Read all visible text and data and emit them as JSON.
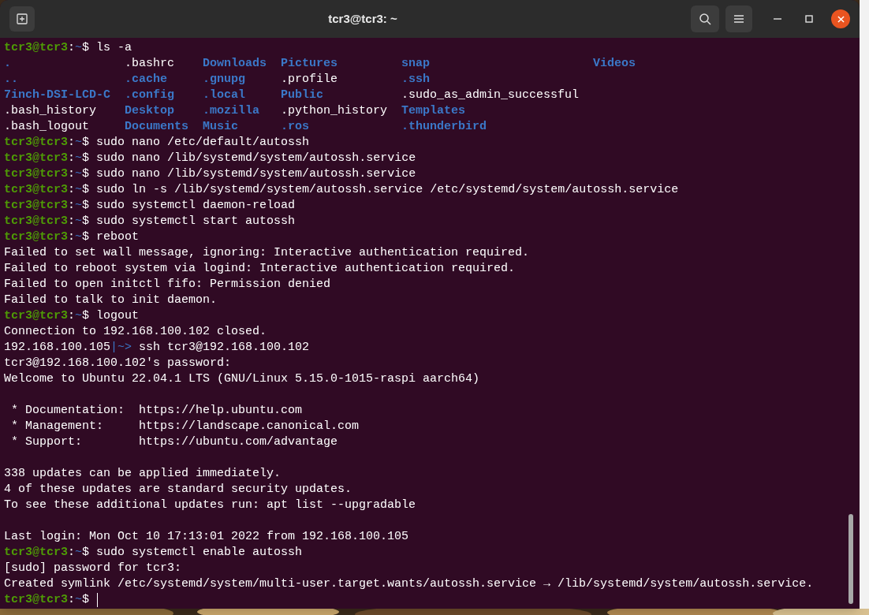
{
  "window": {
    "title": "tcr3@tcr3: ~"
  },
  "terminal": {
    "lines": [
      {
        "kind": "prompt",
        "user_host": "tcr3@tcr3",
        "sep": ":",
        "path": "~",
        "sign": "$",
        "command": "ls -a"
      },
      {
        "kind": "listing",
        "rows": [
          [
            {
              "name": ".",
              "kind": "dir"
            },
            {
              "name": ".bashrc",
              "kind": "file"
            },
            {
              "name": "Downloads",
              "kind": "dir"
            },
            {
              "name": "Pictures",
              "kind": "dir"
            },
            {
              "name": "snap",
              "kind": "dir"
            },
            {
              "name": "Videos",
              "kind": "dir"
            }
          ],
          [
            {
              "name": "..",
              "kind": "dir"
            },
            {
              "name": ".cache",
              "kind": "dir"
            },
            {
              "name": ".gnupg",
              "kind": "dir"
            },
            {
              "name": ".profile",
              "kind": "file"
            },
            {
              "name": ".ssh",
              "kind": "dir"
            }
          ],
          [
            {
              "name": "7inch-DSI-LCD-C",
              "kind": "dir"
            },
            {
              "name": ".config",
              "kind": "dir"
            },
            {
              "name": ".local",
              "kind": "dir"
            },
            {
              "name": "Public",
              "kind": "dir"
            },
            {
              "name": ".sudo_as_admin_successful",
              "kind": "file"
            }
          ],
          [
            {
              "name": ".bash_history",
              "kind": "file"
            },
            {
              "name": "Desktop",
              "kind": "dir"
            },
            {
              "name": ".mozilla",
              "kind": "dir"
            },
            {
              "name": ".python_history",
              "kind": "file"
            },
            {
              "name": "Templates",
              "kind": "dir"
            }
          ],
          [
            {
              "name": ".bash_logout",
              "kind": "file"
            },
            {
              "name": "Documents",
              "kind": "dir"
            },
            {
              "name": "Music",
              "kind": "dir"
            },
            {
              "name": ".ros",
              "kind": "dir"
            },
            {
              "name": ".thunderbird",
              "kind": "dir"
            }
          ]
        ]
      },
      {
        "kind": "prompt",
        "user_host": "tcr3@tcr3",
        "sep": ":",
        "path": "~",
        "sign": "$",
        "command": "sudo nano /etc/default/autossh"
      },
      {
        "kind": "prompt",
        "user_host": "tcr3@tcr3",
        "sep": ":",
        "path": "~",
        "sign": "$",
        "command": "sudo nano /lib/systemd/system/autossh.service"
      },
      {
        "kind": "prompt",
        "user_host": "tcr3@tcr3",
        "sep": ":",
        "path": "~",
        "sign": "$",
        "command": "sudo nano /lib/systemd/system/autossh.service"
      },
      {
        "kind": "prompt",
        "user_host": "tcr3@tcr3",
        "sep": ":",
        "path": "~",
        "sign": "$",
        "command": "sudo ln -s /lib/systemd/system/autossh.service /etc/systemd/system/autossh.service"
      },
      {
        "kind": "prompt",
        "user_host": "tcr3@tcr3",
        "sep": ":",
        "path": "~",
        "sign": "$",
        "command": "sudo systemctl daemon-reload"
      },
      {
        "kind": "prompt",
        "user_host": "tcr3@tcr3",
        "sep": ":",
        "path": "~",
        "sign": "$",
        "command": "sudo systemctl start autossh"
      },
      {
        "kind": "prompt",
        "user_host": "tcr3@tcr3",
        "sep": ":",
        "path": "~",
        "sign": "$",
        "command": "reboot"
      },
      {
        "kind": "output",
        "text": "Failed to set wall message, ignoring: Interactive authentication required."
      },
      {
        "kind": "output",
        "text": "Failed to reboot system via logind: Interactive authentication required."
      },
      {
        "kind": "output",
        "text": "Failed to open initctl fifo: Permission denied"
      },
      {
        "kind": "output",
        "text": "Failed to talk to init daemon."
      },
      {
        "kind": "prompt",
        "user_host": "tcr3@tcr3",
        "sep": ":",
        "path": "~",
        "sign": "$",
        "command": "logout"
      },
      {
        "kind": "output",
        "text": "Connection to 192.168.100.102 closed."
      },
      {
        "kind": "remote_prompt",
        "host": "192.168.100.105",
        "marker": "|~>",
        "command": "ssh tcr3@192.168.100.102"
      },
      {
        "kind": "output",
        "text": "tcr3@192.168.100.102's password:"
      },
      {
        "kind": "output",
        "text": "Welcome to Ubuntu 22.04.1 LTS (GNU/Linux 5.15.0-1015-raspi aarch64)"
      },
      {
        "kind": "blank"
      },
      {
        "kind": "link_row",
        "label": " * Documentation:",
        "url": "https://help.ubuntu.com"
      },
      {
        "kind": "link_row",
        "label": " * Management:",
        "url": "https://landscape.canonical.com"
      },
      {
        "kind": "link_row",
        "label": " * Support:",
        "url": "https://ubuntu.com/advantage"
      },
      {
        "kind": "blank"
      },
      {
        "kind": "output",
        "text": "338 updates can be applied immediately."
      },
      {
        "kind": "output",
        "text": "4 of these updates are standard security updates."
      },
      {
        "kind": "output",
        "text": "To see these additional updates run: apt list --upgradable"
      },
      {
        "kind": "blank"
      },
      {
        "kind": "output",
        "text": "Last login: Mon Oct 10 17:13:01 2022 from 192.168.100.105"
      },
      {
        "kind": "prompt",
        "user_host": "tcr3@tcr3",
        "sep": ":",
        "path": "~",
        "sign": "$",
        "command": "sudo systemctl enable autossh"
      },
      {
        "kind": "output",
        "text": "[sudo] password for tcr3:"
      },
      {
        "kind": "output",
        "text": "Created symlink /etc/systemd/system/multi-user.target.wants/autossh.service → /lib/systemd/system/autossh.service."
      },
      {
        "kind": "prompt",
        "user_host": "tcr3@tcr3",
        "sep": ":",
        "path": "~",
        "sign": "$",
        "cursor": true
      }
    ]
  }
}
